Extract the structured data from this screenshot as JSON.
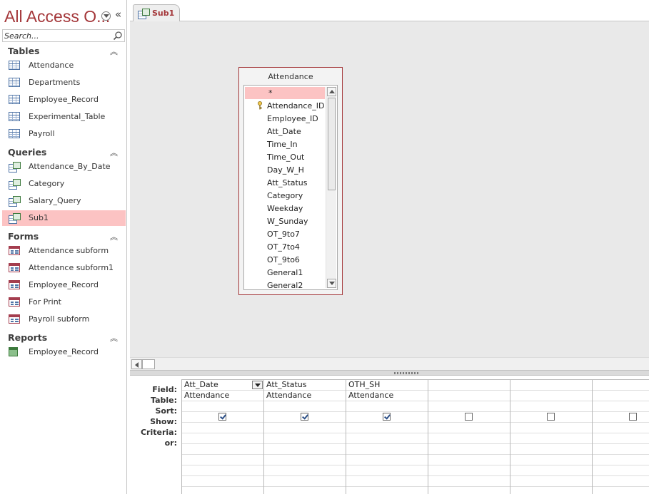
{
  "nav": {
    "title": "All Access O...",
    "search_placeholder": "Search...",
    "sections": [
      {
        "label": "Tables",
        "items": [
          "Attendance",
          "Departments",
          "Employee_Record",
          "Experimental_Table",
          "Payroll"
        ]
      },
      {
        "label": "Queries",
        "items": [
          "Attendance_By_Date",
          "Category",
          "Salary_Query",
          "Sub1"
        ]
      },
      {
        "label": "Forms",
        "items": [
          "Attendance subform",
          "Attendance subform1",
          "Employee_Record",
          "For Print",
          "Payroll subform"
        ]
      },
      {
        "label": "Reports",
        "items": [
          "Employee_Record"
        ]
      }
    ]
  },
  "tab": {
    "label": "Sub1"
  },
  "field_list": {
    "title": "Attendance",
    "fields": [
      "*",
      "Attendance_ID",
      "Employee_ID",
      "Att_Date",
      "Time_In",
      "Time_Out",
      "Day_W_H",
      "Att_Status",
      "Category",
      "Weekday",
      "W_Sunday",
      "OT_9to7",
      "OT_7to4",
      "OT_9to6",
      "General1",
      "General2"
    ]
  },
  "grid": {
    "row_labels": [
      "Field:",
      "Table:",
      "Sort:",
      "Show:",
      "Criteria:",
      "or:"
    ],
    "columns": [
      {
        "field": "Att_Date",
        "table": "Attendance",
        "show": true
      },
      {
        "field": "Att_Status",
        "table": "Attendance",
        "show": true
      },
      {
        "field": "OTH_SH",
        "table": "Attendance",
        "show": true
      },
      {
        "field": "",
        "table": "",
        "show": false
      },
      {
        "field": "",
        "table": "",
        "show": false
      },
      {
        "field": "",
        "table": "",
        "show": false
      }
    ]
  },
  "colors": {
    "accent": "#a4373a",
    "selection": "#fcc3c3"
  }
}
